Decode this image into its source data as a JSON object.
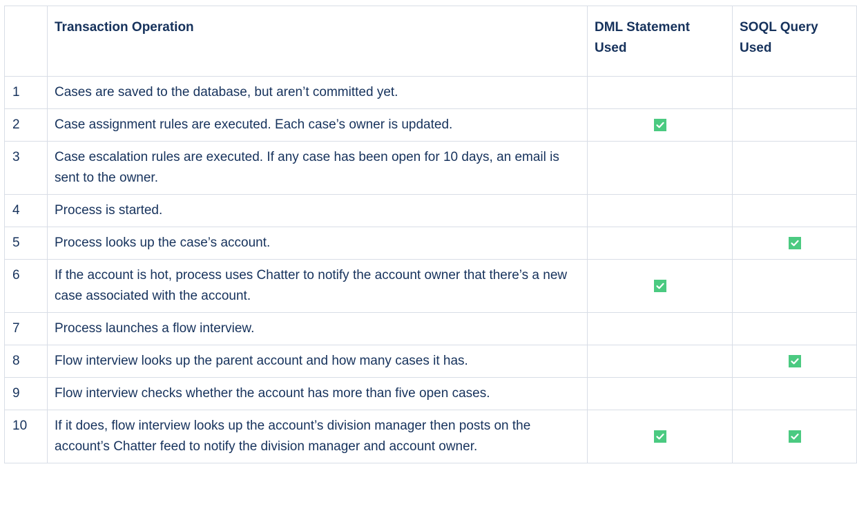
{
  "table": {
    "headers": {
      "index": "",
      "operation": "Transaction Operation",
      "dml": "DML Statement Used",
      "soql": "SOQL Query Used"
    },
    "rows": [
      {
        "n": "1",
        "op": "Cases are saved to the database, but aren’t committed yet.",
        "dml": false,
        "soql": false
      },
      {
        "n": "2",
        "op": "Case assignment rules are executed. Each case’s owner is updated.",
        "dml": true,
        "soql": false
      },
      {
        "n": "3",
        "op": "Case escalation rules are executed. If any case has been open for 10 days, an email is sent to the owner.",
        "dml": false,
        "soql": false
      },
      {
        "n": "4",
        "op": "Process is started.",
        "dml": false,
        "soql": false
      },
      {
        "n": "5",
        "op": "Process looks up the case’s account.",
        "dml": false,
        "soql": true
      },
      {
        "n": "6",
        "op": "If the account is hot, process uses Chatter to notify the account owner that there’s a new case associated with the account.",
        "dml": true,
        "soql": false
      },
      {
        "n": "7",
        "op": "Process launches a flow interview.",
        "dml": false,
        "soql": false
      },
      {
        "n": "8",
        "op": "Flow interview looks up the parent account and how many cases it has.",
        "dml": false,
        "soql": true
      },
      {
        "n": "9",
        "op": "Flow interview checks whether the account has more than five open cases.",
        "dml": false,
        "soql": false
      },
      {
        "n": "10",
        "op": "If it does, flow interview looks up the account’s division manager then posts on the account’s Chatter feed to notify the division manager and account owner.",
        "dml": true,
        "soql": true
      }
    ]
  },
  "icons": {
    "checked": "checkbox-checked-icon"
  },
  "colors": {
    "check_bg": "#4bca81",
    "text": "#16325c",
    "border": "#d8dde6"
  }
}
